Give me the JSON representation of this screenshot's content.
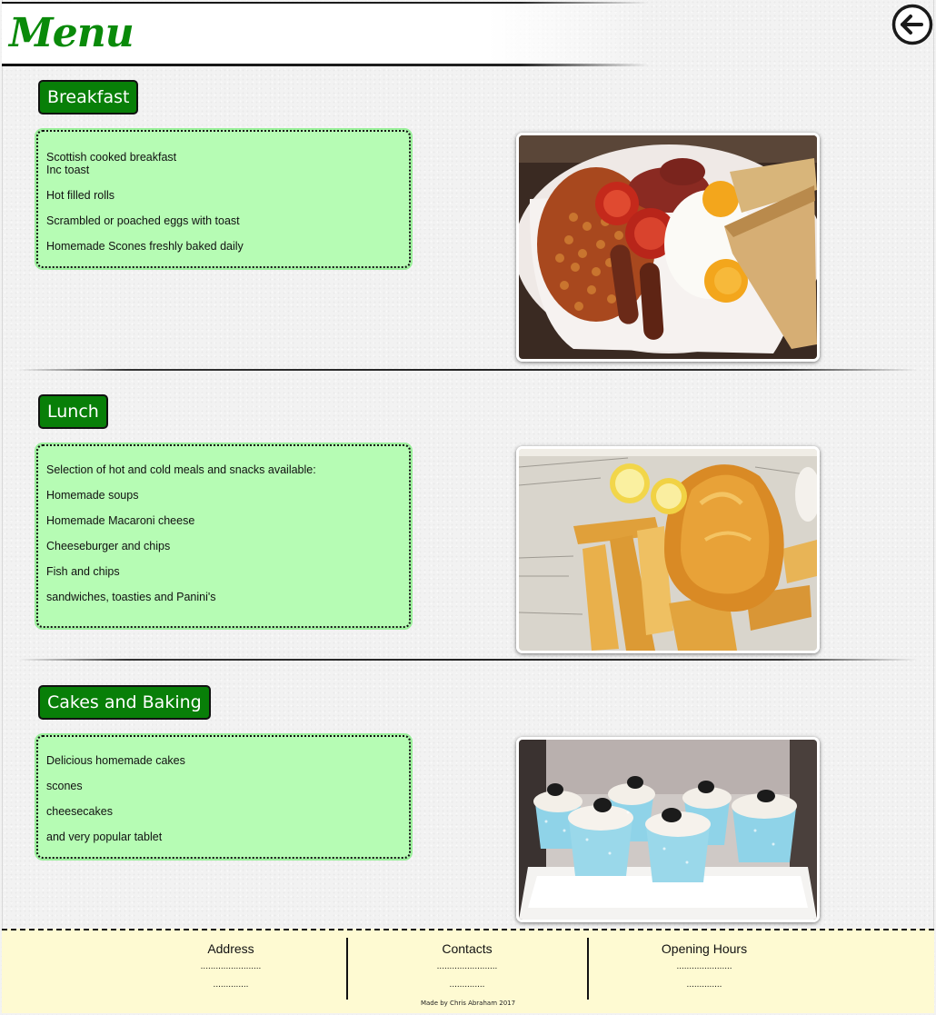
{
  "header": {
    "title": "Menu",
    "back_icon": "arrow-left-circle-icon"
  },
  "sections": [
    {
      "heading": "Breakfast",
      "items": [
        "Scottish cooked breakfast",
        "Inc toast",
        "Hot filled rolls",
        "Scrambled or poached eggs with toast",
        "Homemade Scones freshly baked daily"
      ],
      "photo": "full-breakfast-photo"
    },
    {
      "heading": "Lunch",
      "items": [
        "Selection of hot and cold meals and snacks available:",
        "Homemade soups",
        "Homemade Macaroni cheese",
        "Cheeseburger and chips",
        "Fish and chips",
        "sandwiches, toasties and Panini's"
      ],
      "photo": "fish-and-chips-photo"
    },
    {
      "heading": "Cakes and Baking",
      "items": [
        "Delicious homemade cakes",
        "scones",
        "cheesecakes",
        "and very popular tablet"
      ],
      "photo": "cupcakes-photo"
    }
  ],
  "footer": {
    "address": {
      "title": "Address",
      "line1": "........................",
      "line2": ".............."
    },
    "contacts": {
      "title": "Contacts",
      "line1": "........................",
      "line2": ".............."
    },
    "hours": {
      "title": "Opening Hours",
      "line1": "......................",
      "line2": ".............."
    },
    "credit": "Made by Chris Abraham 2017"
  },
  "colors": {
    "title_green": "#0a8a0a",
    "heading_green": "#087f08",
    "item_box_green": "#b6fcb4",
    "footer_cream": "#fefad2"
  }
}
